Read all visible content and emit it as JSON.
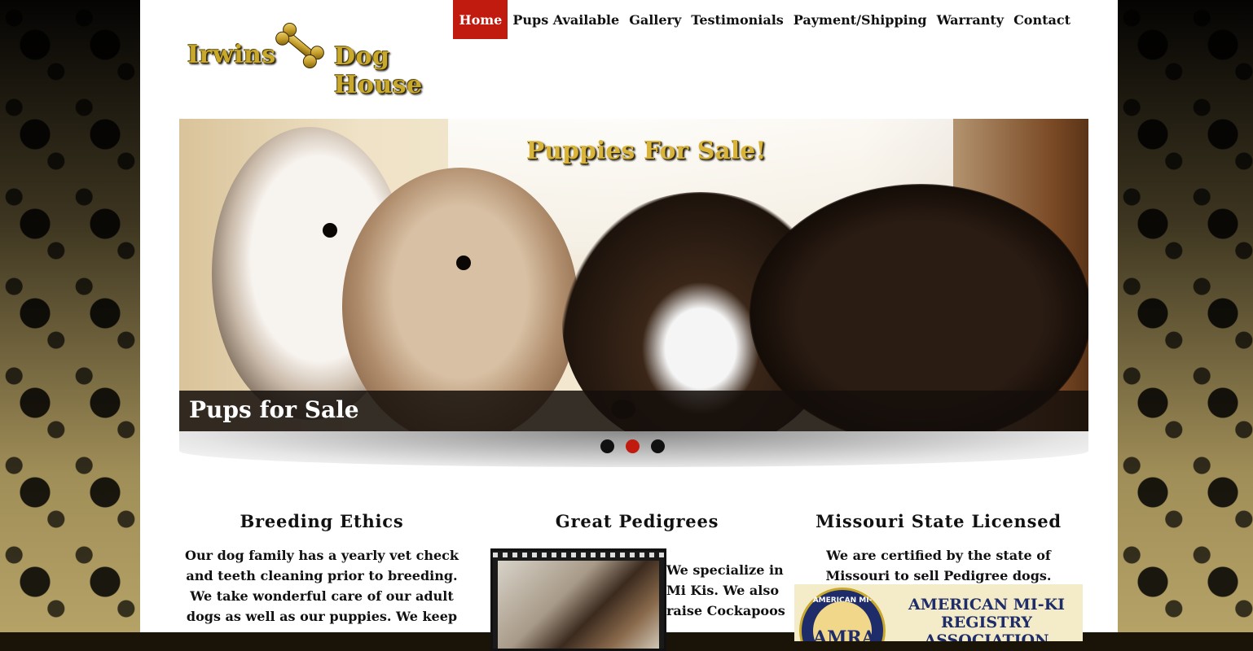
{
  "site": {
    "logo_word1": "Irwins",
    "logo_word2": "Dog House"
  },
  "nav": {
    "items": [
      {
        "label": "Home",
        "active": true
      },
      {
        "label": "Pups Available",
        "active": false
      },
      {
        "label": "Gallery",
        "active": false
      },
      {
        "label": "Testimonials",
        "active": false
      },
      {
        "label": "Payment/Shipping",
        "active": false
      },
      {
        "label": "Warranty",
        "active": false
      },
      {
        "label": "Contact",
        "active": false
      }
    ]
  },
  "slider": {
    "overlay_title": "Puppies For Sale!",
    "caption": "Pups for Sale",
    "slide_count": 3,
    "active_slide": 2
  },
  "features": [
    {
      "heading": "Breeding Ethics",
      "text": "Our dog family has a yearly vet check and teeth cleaning prior to breeding. We take wonderful care of our adult dogs as well as our puppies. We keep"
    },
    {
      "heading": "Great Pedigrees",
      "text": "We specialize in Mi Kis. We also raise Cockapoos"
    },
    {
      "heading": "Missouri State Licensed",
      "text": "We are certified by the state of Missouri to sell Pedigree dogs.",
      "badge": {
        "seal_ring": "AMERICAN MI-KI",
        "seal_center": "AMRA",
        "org_name_line1": "AMERICAN MI-KI",
        "org_name_line2": "REGISTRY ASSOCIATION"
      }
    }
  ],
  "colors": {
    "accent_red": "#c11b0f",
    "logo_gold": "#c9a92c",
    "text": "#111111"
  }
}
